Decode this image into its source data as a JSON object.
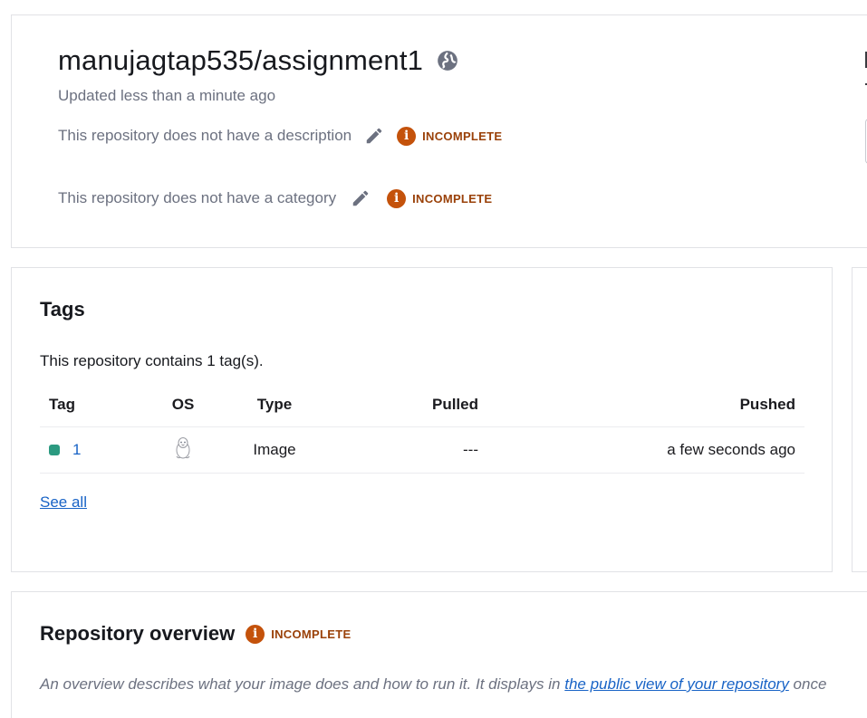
{
  "repo": {
    "name": "manujagtap535/assignment1",
    "updated": "Updated less than a minute ago",
    "visibility_icon": "globe-icon",
    "description_text": "This repository does not have a description",
    "category_text": "This repository does not have a category",
    "incomplete_label": "INCOMPLETE"
  },
  "tags": {
    "title": "Tags",
    "count_text": "This repository contains 1 tag(s).",
    "columns": [
      "Tag",
      "OS",
      "Type",
      "Pulled",
      "Pushed"
    ],
    "rows": [
      {
        "tag": "1",
        "os_icon": "linux-icon",
        "type": "Image",
        "pulled": "---",
        "pushed": "a few seconds ago"
      }
    ],
    "see_all": "See all"
  },
  "overview": {
    "title": "Repository overview",
    "incomplete_label": "INCOMPLETE",
    "desc_before": "An overview describes what your image does and how to run it. It displays in ",
    "desc_link": "the public view of your repository",
    "desc_after": " once"
  },
  "colors": {
    "incomplete": "#c4520b",
    "link": "#1863c6",
    "tag_status": "#2b9a80"
  }
}
